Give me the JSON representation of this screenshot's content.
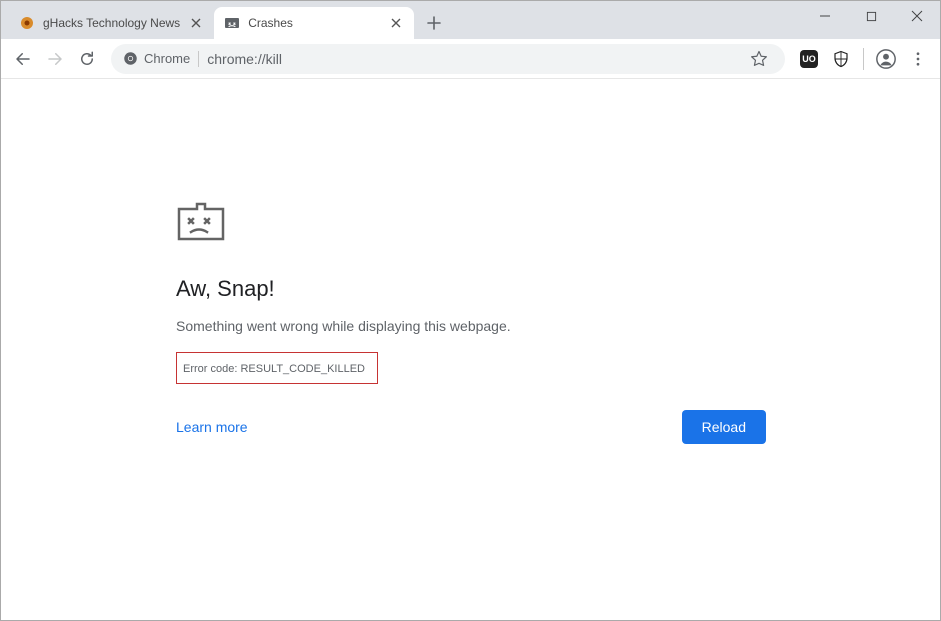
{
  "tabs": [
    {
      "title": "gHacks Technology News",
      "active": false
    },
    {
      "title": "Crashes",
      "active": true
    }
  ],
  "omnibox": {
    "scheme_label": "Chrome",
    "url": "chrome://kill"
  },
  "extensions": {
    "ublock_label": "UO"
  },
  "page": {
    "heading": "Aw, Snap!",
    "message": "Something went wrong while displaying this webpage.",
    "error_code": "Error code: RESULT_CODE_KILLED",
    "learn_more": "Learn more",
    "reload": "Reload"
  }
}
